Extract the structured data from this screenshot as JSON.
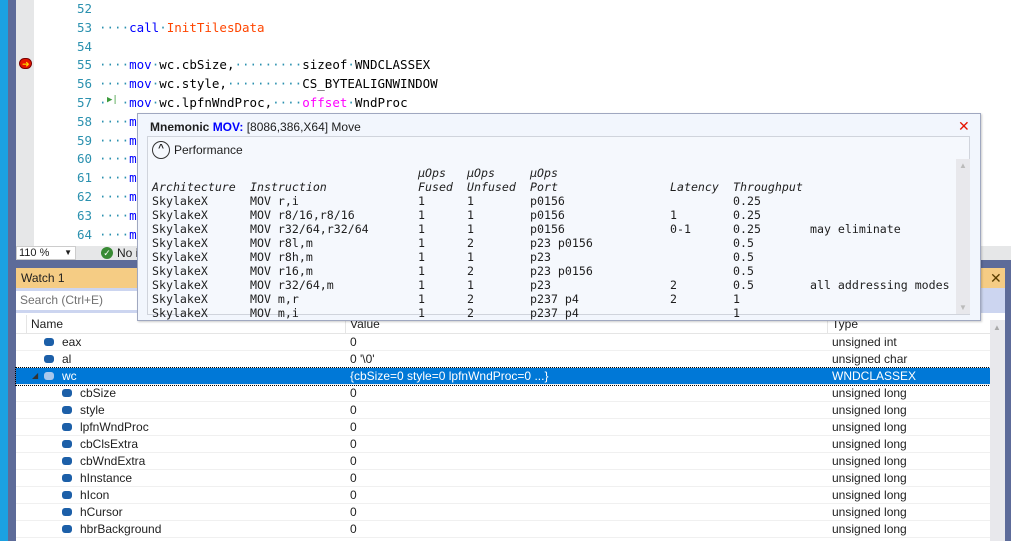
{
  "editor": {
    "lines": [
      {
        "num": "52",
        "parts": []
      },
      {
        "num": "53",
        "parts": [
          [
            "ws",
            "····"
          ],
          [
            "kw",
            "call"
          ],
          [
            "ws",
            "·"
          ],
          [
            "fn",
            "InitTilesData"
          ]
        ]
      },
      {
        "num": "54",
        "parts": []
      },
      {
        "num": "55",
        "parts": [
          [
            "ws",
            "····"
          ],
          [
            "kw",
            "mov"
          ],
          [
            "ws",
            "·"
          ],
          [
            "",
            "wc.cbSize,"
          ],
          [
            "ws",
            "·········"
          ],
          [
            "",
            "sizeof"
          ],
          [
            "ws",
            "·"
          ],
          [
            "",
            "WNDCLASSEX"
          ]
        ]
      },
      {
        "num": "56",
        "parts": [
          [
            "ws",
            "····"
          ],
          [
            "kw",
            "mov"
          ],
          [
            "ws",
            "·"
          ],
          [
            "",
            "wc.style,"
          ],
          [
            "ws",
            "··········"
          ],
          [
            "",
            "CS_BYTEALIGNWINDOW"
          ]
        ]
      },
      {
        "num": "57",
        "parts": [
          [
            "ws",
            "·"
          ],
          [
            "ws",
            "  "
          ],
          [
            "ws",
            "·"
          ],
          [
            "kw",
            "mov"
          ],
          [
            "ws",
            "·"
          ],
          [
            "",
            "wc.lpfnWndProc,"
          ],
          [
            "ws",
            "····"
          ],
          [
            "mg",
            "offset"
          ],
          [
            "ws",
            "·"
          ],
          [
            "",
            "WndProc"
          ]
        ]
      },
      {
        "num": "58",
        "parts": [
          [
            "ws",
            "····"
          ],
          [
            "kw",
            "m"
          ]
        ]
      },
      {
        "num": "59",
        "parts": [
          [
            "ws",
            "····"
          ],
          [
            "kw",
            "m"
          ]
        ]
      },
      {
        "num": "60",
        "parts": [
          [
            "ws",
            "····"
          ],
          [
            "kw",
            "m"
          ]
        ]
      },
      {
        "num": "61",
        "parts": [
          [
            "ws",
            "····"
          ],
          [
            "kw",
            "m"
          ]
        ]
      },
      {
        "num": "62",
        "parts": [
          [
            "ws",
            "····"
          ],
          [
            "kw",
            "m"
          ]
        ]
      },
      {
        "num": "63",
        "parts": [
          [
            "ws",
            "····"
          ],
          [
            "kw",
            "m"
          ]
        ]
      },
      {
        "num": "64",
        "parts": [
          [
            "ws",
            "····"
          ],
          [
            "kw",
            "m"
          ]
        ]
      }
    ],
    "breakpoint_line": "55",
    "current_line": "57"
  },
  "status": {
    "zoom": "110 %",
    "issues": "No i"
  },
  "watch": {
    "title": "Watch 1",
    "search_placeholder": "Search (Ctrl+E)",
    "columns": [
      "Name",
      "Value",
      "Type"
    ],
    "rows": [
      {
        "name": "eax",
        "value": "0",
        "type": "unsigned int",
        "level": 0
      },
      {
        "name": "al",
        "value": "0 '\\0'",
        "type": "unsigned char",
        "level": 0
      },
      {
        "name": "wc",
        "value": "{cbSize=0 style=0 lpfnWndProc=0 ...}",
        "type": "WNDCLASSEX",
        "level": 0,
        "expanded": true,
        "selected": true
      },
      {
        "name": "cbSize",
        "value": "0",
        "type": "unsigned long",
        "level": 1
      },
      {
        "name": "style",
        "value": "0",
        "type": "unsigned long",
        "level": 1
      },
      {
        "name": "lpfnWndProc",
        "value": "0",
        "type": "unsigned long",
        "level": 1
      },
      {
        "name": "cbClsExtra",
        "value": "0",
        "type": "unsigned long",
        "level": 1
      },
      {
        "name": "cbWndExtra",
        "value": "0",
        "type": "unsigned long",
        "level": 1
      },
      {
        "name": "hInstance",
        "value": "0",
        "type": "unsigned long",
        "level": 1
      },
      {
        "name": "hIcon",
        "value": "0",
        "type": "unsigned long",
        "level": 1
      },
      {
        "name": "hCursor",
        "value": "0",
        "type": "unsigned long",
        "level": 1
      },
      {
        "name": "hbrBackground",
        "value": "0",
        "type": "unsigned long",
        "level": 1
      }
    ]
  },
  "tooltip": {
    "label": "Mnemonic",
    "mnemonic": "MOV",
    "colon": ":",
    "desc": " [8086,386,X64] Move",
    "section": "Performance",
    "header1": [
      "",
      "",
      "µOps",
      "µOps",
      "µOps",
      "",
      "",
      ""
    ],
    "header2": [
      "Architecture",
      "Instruction",
      "Fused",
      "Unfused",
      "Port",
      "Latency",
      "Throughput",
      ""
    ],
    "rows": [
      [
        "SkylakeX",
        "MOV r,i",
        "1",
        "1",
        "p0156",
        "",
        "0.25",
        ""
      ],
      [
        "SkylakeX",
        "MOV r8/16,r8/16",
        "1",
        "1",
        "p0156",
        "1",
        "0.25",
        ""
      ],
      [
        "SkylakeX",
        "MOV r32/64,r32/64",
        "1",
        "1",
        "p0156",
        "0-1",
        "0.25",
        "may eliminate"
      ],
      [
        "SkylakeX",
        "MOV r8l,m",
        "1",
        "2",
        "p23 p0156",
        "",
        "0.5",
        ""
      ],
      [
        "SkylakeX",
        "MOV r8h,m",
        "1",
        "1",
        "p23",
        "",
        "0.5",
        ""
      ],
      [
        "SkylakeX",
        "MOV r16,m",
        "1",
        "2",
        "p23 p0156",
        "",
        "0.5",
        ""
      ],
      [
        "SkylakeX",
        "MOV r32/64,m",
        "1",
        "1",
        "p23",
        "2",
        "0.5",
        "all addressing modes"
      ],
      [
        "SkylakeX",
        "MOV m,r",
        "1",
        "2",
        "p237 p4",
        "2",
        "1",
        ""
      ],
      [
        "SkylakeX",
        "MOV m,i",
        "1",
        "2",
        "p237 p4",
        "",
        "1",
        ""
      ]
    ]
  }
}
